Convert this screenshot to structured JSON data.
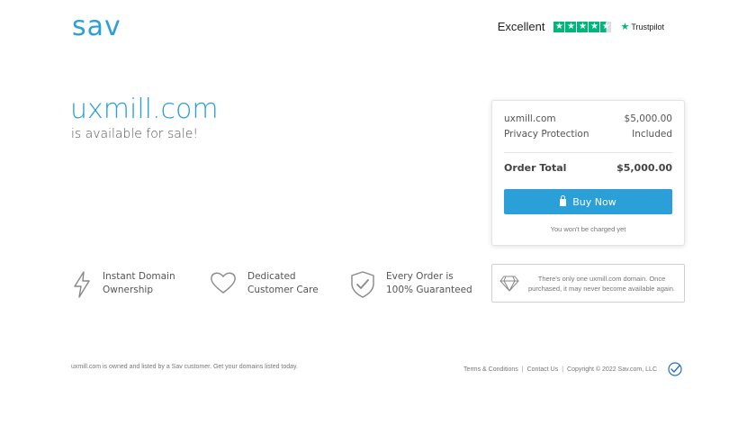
{
  "header": {
    "logo": "sav",
    "trustpilot": {
      "label": "Excellent",
      "brand": "Trustpilot",
      "rating_stars": 4.5
    }
  },
  "hero": {
    "domain": "uxmill.com",
    "availability": "is available for sale!"
  },
  "order": {
    "lines": [
      {
        "name": "uxmill.com",
        "value": "$5,000.00"
      },
      {
        "name": "Privacy Protection",
        "value": "Included"
      }
    ],
    "total_label": "Order Total",
    "total_value": "$5,000.00",
    "buy_label": "Buy Now",
    "note": "You won't be charged yet"
  },
  "features": [
    {
      "icon": "lightning-icon",
      "line1": "Instant Domain",
      "line2": "Ownership"
    },
    {
      "icon": "heart-icon",
      "line1": "Dedicated",
      "line2": "Customer Care"
    },
    {
      "icon": "shield-check-icon",
      "line1": "Every Order is",
      "line2": "100% Guaranteed"
    }
  ],
  "info_box": {
    "icon": "diamond-icon",
    "line1": "There's only one uxmill.com domain. Once",
    "line2": "purchased, it may never become available again."
  },
  "footer": {
    "left": "uxmill.com is owned and listed by a Sav customer. Get your domains listed today.",
    "terms": "Terms & Conditions",
    "contact": "Contact Us",
    "copyright": "Copyright © 2022 Sav.com, LLC"
  },
  "colors": {
    "brand_blue": "#2a9fd8",
    "trustpilot_green": "#00b67a"
  }
}
